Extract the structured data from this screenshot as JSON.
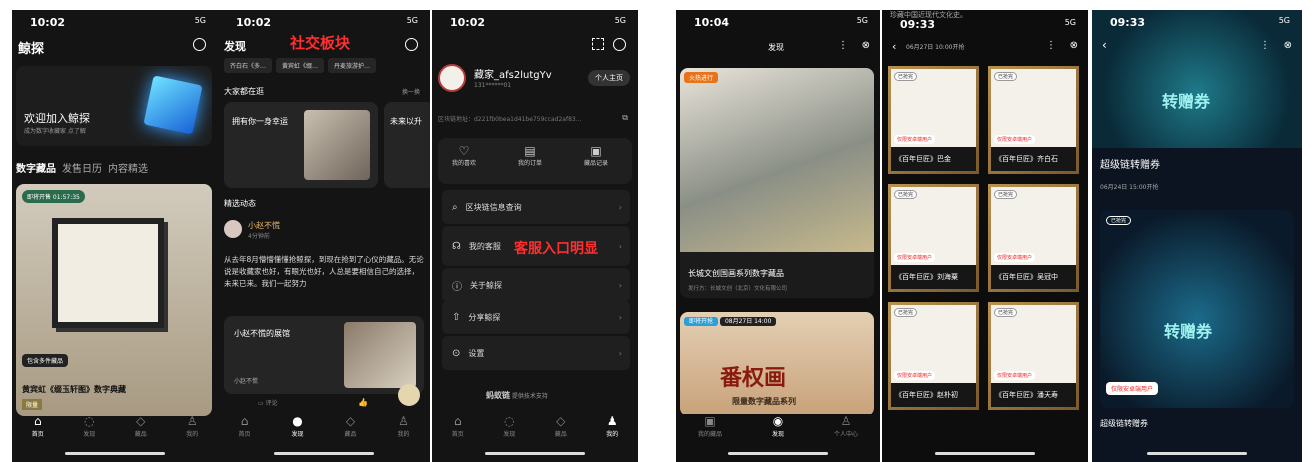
{
  "p1": {
    "time": "10:02",
    "sig": "5G",
    "title": "鲸探",
    "banner_t": "欢迎加入鲸探",
    "banner_s": "成为数字收藏家 点了解",
    "tabs": [
      "数字藏品",
      "发售日历",
      "内容精选"
    ],
    "badge": "即将开售 01:57:35",
    "multi": "包含多件藏品",
    "name": "黄宾虹《缀玉轩图》数字典藏",
    "limit": "限量",
    "nav": [
      "首页",
      "发现",
      "藏品",
      "我的"
    ]
  },
  "p2": {
    "time": "10:02",
    "title": "发现",
    "red": "社交板块",
    "chips": [
      "齐白石《多…",
      "黄宾虹《缀…",
      "丹麦旅游护…"
    ],
    "sec": "大家都在逛",
    "more": "换一换",
    "c1": "拥有你一身幸运",
    "c2": "未来以升",
    "sec2": "精选动态",
    "user": "小赵不慌",
    "ago": "4分钟前",
    "post": "从去年8月懵懵懂懂抢鲸探，到现在抢到了心仪的藏品。无论说是收藏家也好，有眼光也好，人总是要相信自己的选择，未来已来。我们一起努力",
    "hall": "小赵不慌的展馆",
    "hall_u": "小赵不慌",
    "comment": "评论",
    "nav": [
      "首页",
      "发现",
      "藏品",
      "我的"
    ]
  },
  "p3": {
    "time": "10:02",
    "user": "藏家_afs2lutgYv",
    "uid": "131******01",
    "home": "个人主页",
    "addr": "区块链地址：d221fb0bea1d41be759ccad2af83…",
    "icons": [
      "我的喜欢",
      "我的订单",
      "藏品记录"
    ],
    "rows": [
      "区块链信息查询",
      "我的客服",
      "关于鲸探",
      "分享鲸探",
      "设置"
    ],
    "red": "客服入口明显",
    "tech": "蚂蚁链",
    "tech2": "提供技术支持",
    "nav": [
      "首页",
      "发现",
      "藏品",
      "我的"
    ]
  },
  "p4": {
    "time": "10:04",
    "title": "发现",
    "badge1": "火热进行",
    "art1": "长城文创国画系列数字藏品",
    "pub": "发行方：长城文创（北京）文化有限公司",
    "badge2": "即将开抢",
    "date2": "08月27日 14:00",
    "art2": "番权画",
    "art2s": "限量数字藏品系列",
    "nav": [
      "我的藏品",
      "发现",
      "个人中心"
    ]
  },
  "p5": {
    "time": "09:33",
    "note": "珍藏中国近现代文化史。",
    "date": "06月27日 10:00开抢",
    "items": [
      {
        "b": "已抢完",
        "r": "仅限安卓端用户",
        "c": "《百年巨匠》巴金"
      },
      {
        "b": "已抢完",
        "r": "仅限安卓端用户",
        "c": "《百年巨匠》齐白石"
      },
      {
        "b": "已抢完",
        "r": "仅限安卓端用户",
        "c": "《百年巨匠》刘海粟"
      },
      {
        "b": "已抢完",
        "r": "仅限安卓端用户",
        "c": "《百年巨匠》吴冠中"
      },
      {
        "b": "已抢完",
        "r": "仅限安卓端用户",
        "c": "《百年巨匠》赵朴初"
      },
      {
        "b": "已抢完",
        "r": "仅限安卓端用户",
        "c": "《百年巨匠》潘天寿"
      }
    ]
  },
  "p6": {
    "time": "09:33",
    "sig": "5G",
    "coupon": "转赠券",
    "title": "超级链转赠券",
    "date": "06月24日 15:00开抢",
    "badge": "已抢完",
    "coupon2": "转赠券",
    "r": "仅限安卓端用户",
    "name": "超级链转赠券"
  }
}
